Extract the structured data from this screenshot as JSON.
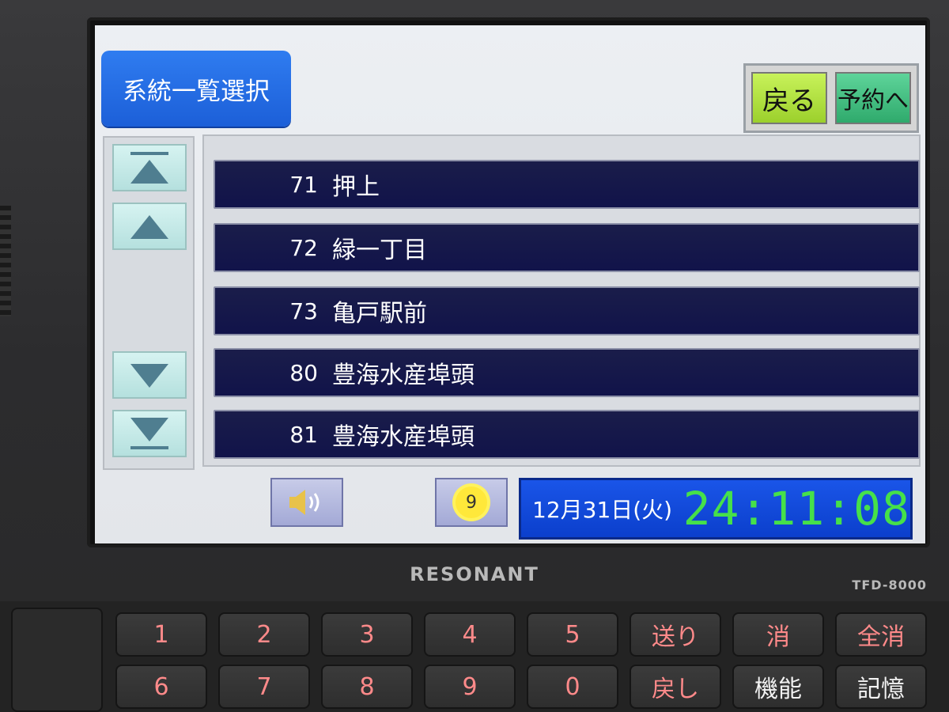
{
  "screen": {
    "title": "系統一覧選択",
    "buttons": {
      "back": "戻る",
      "reserve": "予約へ"
    },
    "list": [
      {
        "number": "71",
        "name": "押上"
      },
      {
        "number": "72",
        "name": "緑一丁目"
      },
      {
        "number": "73",
        "name": "亀戸駅前"
      },
      {
        "number": "80",
        "name": "豊海水産埠頭"
      },
      {
        "number": "81",
        "name": "豊海水産埠頭"
      }
    ],
    "volume_icon": "speaker-icon",
    "brightness_icon": "sun-icon",
    "brightness_value": "9",
    "date": "12月31日(火)",
    "time": "24:11:08"
  },
  "device": {
    "brand": "RESONANT",
    "model": "TFD-8000"
  },
  "keypad": {
    "row1": [
      "1",
      "2",
      "3",
      "4",
      "5",
      "送り",
      "消",
      "全消"
    ],
    "row2": [
      "6",
      "7",
      "8",
      "9",
      "0",
      "戻し",
      "機能",
      "記憶"
    ]
  },
  "colors": {
    "title_bg": "#2f7cf0",
    "row_bg": "#11134a",
    "back_button": "#b8e64a",
    "reserve_button": "#3fbe7e",
    "clock_bg": "#1a55e8",
    "time_text": "#46e04a",
    "key_text_red": "#ff8a8a"
  }
}
